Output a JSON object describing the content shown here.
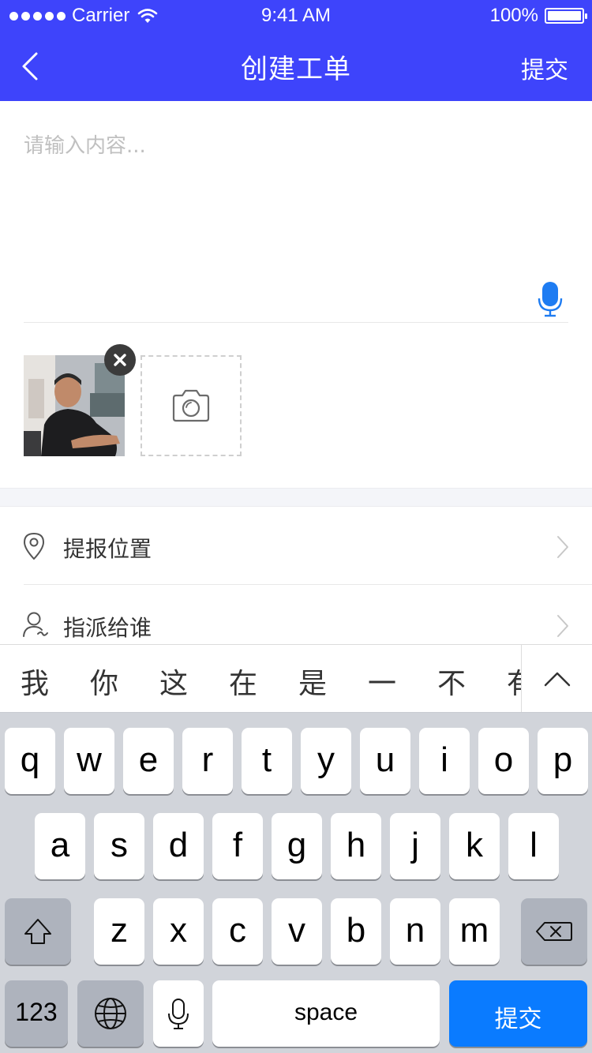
{
  "status_bar": {
    "carrier": "Carrier",
    "time": "9:41 AM",
    "battery": "100%"
  },
  "nav": {
    "title": "创建工单",
    "submit": "提交"
  },
  "content": {
    "placeholder": "请输入内容..."
  },
  "rows": [
    {
      "label": "提报位置",
      "icon": "location-pin-icon"
    },
    {
      "label": "指派给谁",
      "icon": "person-icon"
    }
  ],
  "candidates": [
    "我",
    "你",
    "这",
    "在",
    "是",
    "一",
    "不",
    "有"
  ],
  "keyboard": {
    "row1": [
      "q",
      "w",
      "e",
      "r",
      "t",
      "y",
      "u",
      "i",
      "o",
      "p"
    ],
    "row2": [
      "a",
      "s",
      "d",
      "f",
      "g",
      "h",
      "j",
      "k",
      "l"
    ],
    "row3": [
      "z",
      "x",
      "c",
      "v",
      "b",
      "n",
      "m"
    ],
    "numbers": "123",
    "space": "space",
    "return": "提交"
  },
  "colors": {
    "accent": "#3e44fb",
    "return_key": "#0a7bff",
    "mic": "#1e7cf2"
  }
}
